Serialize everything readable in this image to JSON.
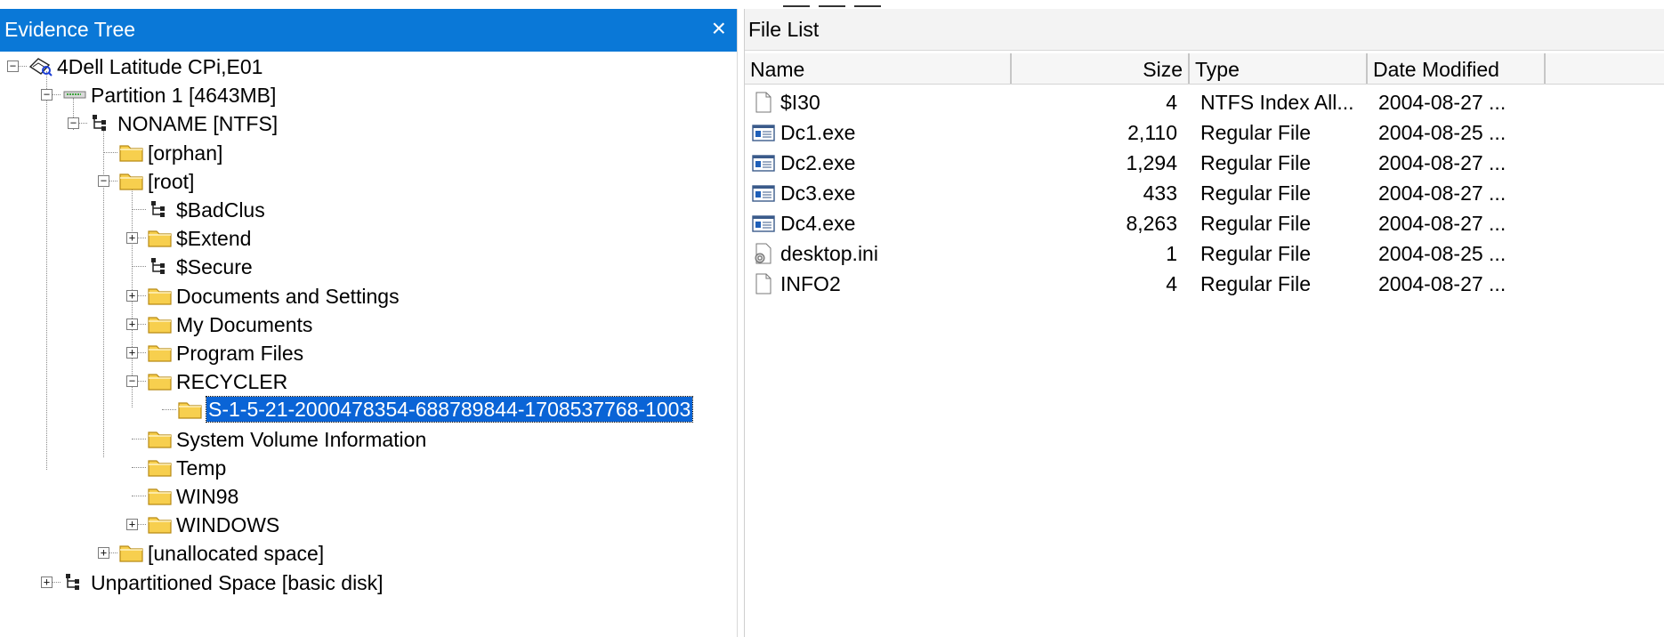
{
  "left_panel": {
    "title": "Evidence Tree",
    "close_glyph": "×",
    "tree": [
      {
        "id": "evidence",
        "label": "4Dell Latitude CPi,E01",
        "icon": "evidence-drive-icon",
        "expander": "−"
      },
      {
        "id": "partition1",
        "label": "Partition 1 [4643MB]",
        "icon": "partition-icon",
        "expander": "−"
      },
      {
        "id": "noname",
        "label": "NONAME [NTFS]",
        "icon": "filesystem-icon",
        "expander": "−"
      },
      {
        "id": "orphan",
        "label": "[orphan]",
        "icon": "folder-icon"
      },
      {
        "id": "root",
        "label": "[root]",
        "icon": "folder-icon",
        "expander": "−"
      },
      {
        "id": "badclus",
        "label": "$BadClus",
        "icon": "filesystem-icon"
      },
      {
        "id": "extend",
        "label": "$Extend",
        "icon": "folder-icon",
        "expander": "+"
      },
      {
        "id": "secure",
        "label": "$Secure",
        "icon": "filesystem-icon"
      },
      {
        "id": "docs_settings",
        "label": "Documents and Settings",
        "icon": "folder-icon",
        "expander": "+"
      },
      {
        "id": "my_documents",
        "label": "My Documents",
        "icon": "folder-icon",
        "expander": "+"
      },
      {
        "id": "program_files",
        "label": "Program Files",
        "icon": "folder-icon",
        "expander": "+"
      },
      {
        "id": "recycler",
        "label": "RECYCLER",
        "icon": "folder-icon",
        "expander": "−"
      },
      {
        "id": "sid_folder",
        "label": "S-1-5-21-2000478354-688789844-1708537768-1003",
        "icon": "folder-icon",
        "selected": true
      },
      {
        "id": "sysvol",
        "label": "System Volume Information",
        "icon": "folder-icon"
      },
      {
        "id": "temp",
        "label": "Temp",
        "icon": "folder-icon"
      },
      {
        "id": "win98",
        "label": "WIN98",
        "icon": "folder-icon"
      },
      {
        "id": "windows",
        "label": "WINDOWS",
        "icon": "folder-icon",
        "expander": "+"
      },
      {
        "id": "unallocated",
        "label": "[unallocated space]",
        "icon": "folder-icon",
        "expander": "+"
      },
      {
        "id": "unpartitioned",
        "label": "Unpartitioned Space [basic disk]",
        "icon": "filesystem-icon",
        "expander": "+"
      }
    ]
  },
  "right_panel": {
    "title": "File List",
    "columns": {
      "name": "Name",
      "size": "Size",
      "type": "Type",
      "date": "Date Modified"
    },
    "files": [
      {
        "name": "$I30",
        "size": "4",
        "type": "NTFS Index All...",
        "date": "2004-08-27 ...",
        "icon": "blank-file-icon"
      },
      {
        "name": "Dc1.exe",
        "size": "2,110",
        "type": "Regular File",
        "date": "2004-08-25 ...",
        "icon": "executable-icon"
      },
      {
        "name": "Dc2.exe",
        "size": "1,294",
        "type": "Regular File",
        "date": "2004-08-27 ...",
        "icon": "executable-icon"
      },
      {
        "name": "Dc3.exe",
        "size": "433",
        "type": "Regular File",
        "date": "2004-08-27 ...",
        "icon": "executable-icon"
      },
      {
        "name": "Dc4.exe",
        "size": "8,263",
        "type": "Regular File",
        "date": "2004-08-27 ...",
        "icon": "executable-icon"
      },
      {
        "name": "desktop.ini",
        "size": "1",
        "type": "Regular File",
        "date": "2004-08-25 ...",
        "icon": "settings-file-icon"
      },
      {
        "name": "INFO2",
        "size": "4",
        "type": "Regular File",
        "date": "2004-08-27 ...",
        "icon": "blank-file-icon"
      }
    ]
  },
  "colors": {
    "header_blue": "#0a78d7",
    "selection_blue": "#0a64d6",
    "folder_yellow": "#f7cf4e"
  }
}
